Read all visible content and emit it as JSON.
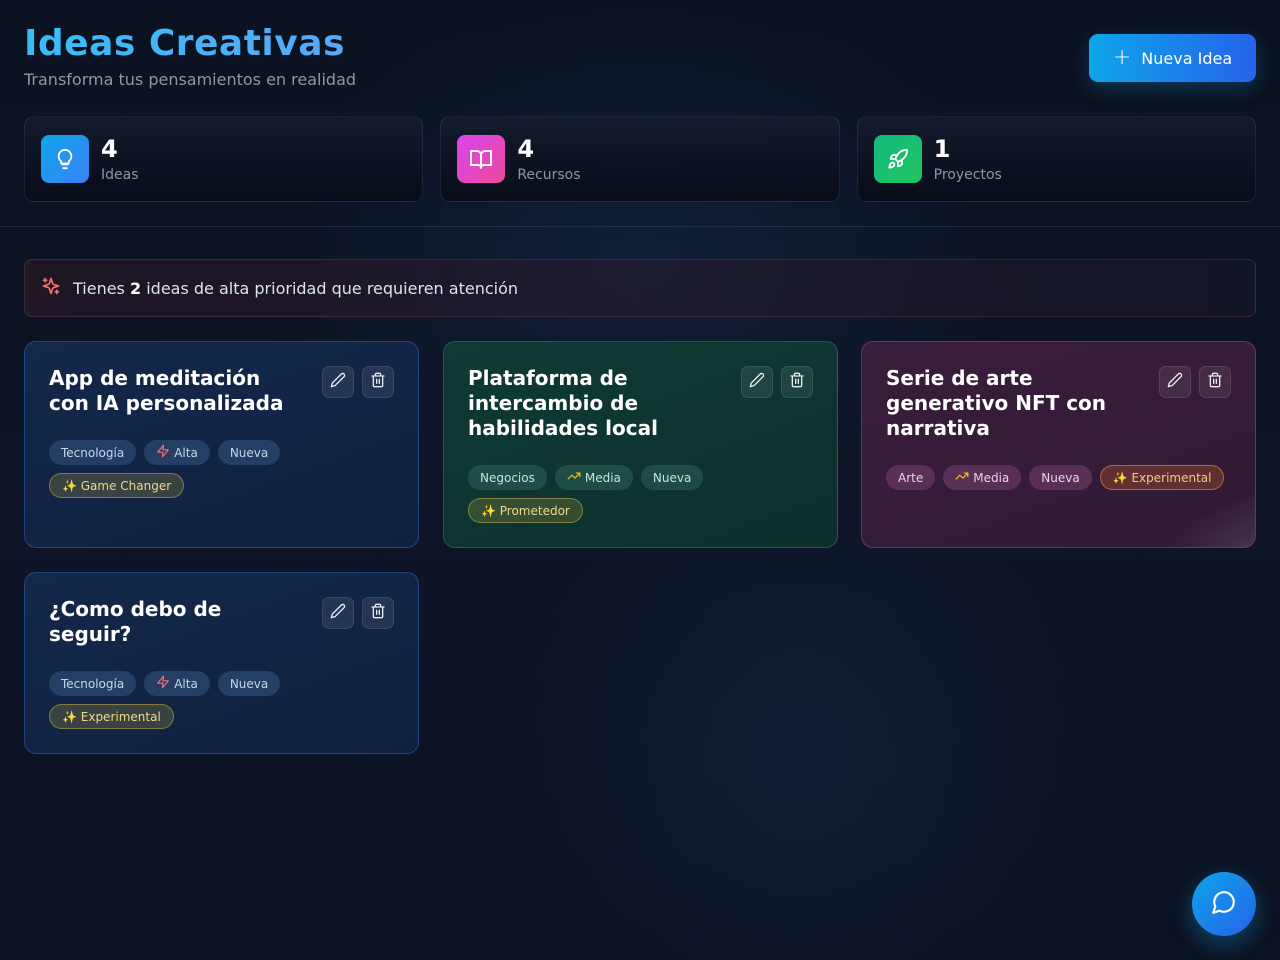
{
  "header": {
    "title": "Ideas Creativas",
    "subtitle": "Transforma tus pensamientos en realidad",
    "new_button_label": "Nueva Idea"
  },
  "stats": [
    {
      "value": "4",
      "label": "Ideas",
      "icon": "lightbulb-icon",
      "color": "#0ea5e9"
    },
    {
      "value": "4",
      "label": "Recursos",
      "icon": "book-icon",
      "color": "#d946ef"
    },
    {
      "value": "1",
      "label": "Proyectos",
      "icon": "rocket-icon",
      "color": "#10b981"
    }
  ],
  "alert": {
    "prefix": "Tienes",
    "count": "2",
    "suffix": "ideas de alta prioridad que requieren atención"
  },
  "cards": [
    {
      "title": "App de meditación con IA personalizada",
      "tags": [
        "Tecnología",
        "Alta",
        "Nueva"
      ],
      "badge": "✨ Game Changer"
    },
    {
      "title": "Plataforma de intercambio de habilidades local",
      "tags": [
        "Negocios",
        "Media",
        "Nueva"
      ],
      "badge": "✨ Prometedor"
    },
    {
      "title": "Serie de arte generativo NFT con narrativa",
      "tags": [
        "Arte",
        "Media",
        "Nueva"
      ],
      "badge": "✨ Experimental"
    },
    {
      "title": "¿Como debo de seguir?",
      "tags": [
        "Tecnología",
        "Alta",
        "Nueva"
      ],
      "badge": "✨ Experimental"
    }
  ],
  "colors": {
    "accent": "#0ea5e9",
    "alta": "#f87171",
    "media": "#fbbf24"
  }
}
